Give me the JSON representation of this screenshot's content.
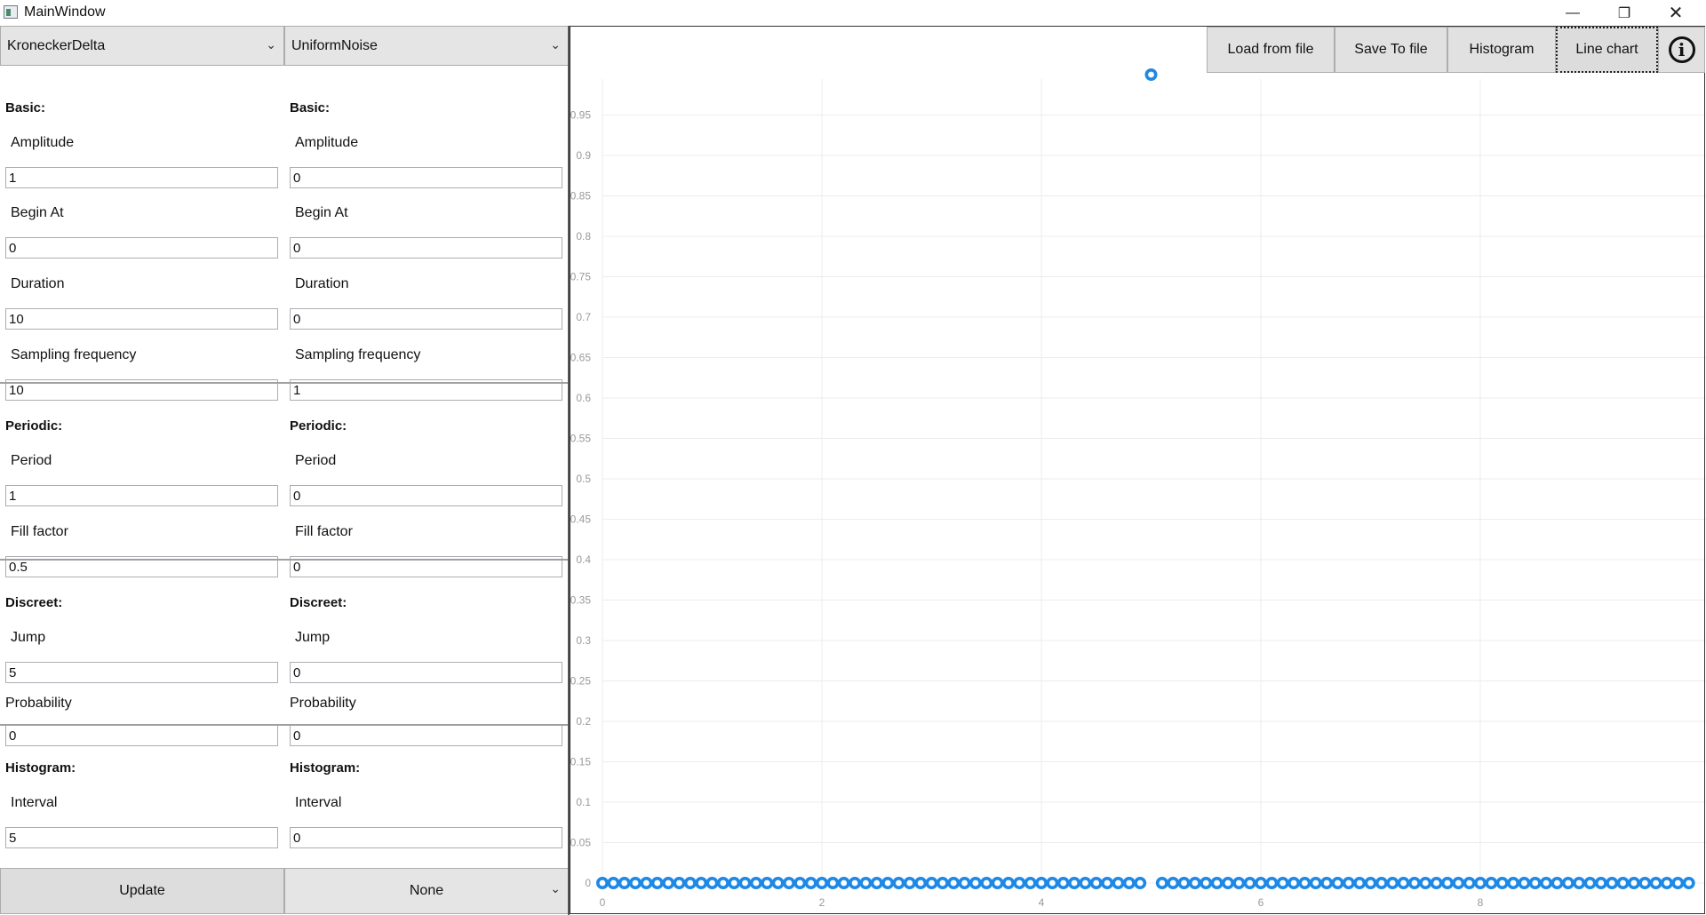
{
  "window": {
    "title": "MainWindow",
    "minimize_icon": "minimize-icon",
    "maximize_icon": "restore-icon",
    "close_icon": "close-icon"
  },
  "left": {
    "signal_select": "KroneckerDelta",
    "basic_title": "Basic:",
    "amplitude_label": "Amplitude",
    "amplitude": "1",
    "begin_label": "Begin At",
    "begin": "0",
    "duration_label": "Duration",
    "duration": "10",
    "sampling_label": "Sampling frequency",
    "sampling": "10",
    "periodic_title": "Periodic:",
    "period_label": "Period",
    "period": "1",
    "fill_label": "Fill factor",
    "fill": "0.5",
    "discreet_title": "Discreet:",
    "jump_label": "Jump",
    "jump": "5",
    "probability_label": "Probability",
    "probability": "0",
    "histogram_title": "Histogram:",
    "interval_label": "Interval",
    "interval": "5"
  },
  "right_form": {
    "signal_select": "UniformNoise",
    "basic_title": "Basic:",
    "amplitude_label": "Amplitude",
    "amplitude": "0",
    "begin_label": "Begin At",
    "begin": "0",
    "duration_label": "Duration",
    "duration": "0",
    "sampling_label": "Sampling frequency",
    "sampling": "1",
    "periodic_title": "Periodic:",
    "period_label": "Period",
    "period": "0",
    "fill_label": "Fill factor",
    "fill": "0",
    "discreet_title": "Discreet:",
    "jump_label": "Jump",
    "jump": "0",
    "probability_label": "Probability",
    "probability": "0",
    "histogram_title": "Histogram:",
    "interval_label": "Interval",
    "interval": "0"
  },
  "bottom": {
    "update_label": "Update",
    "operation_select": "None"
  },
  "toolbar": {
    "load_label": "Load from file",
    "save_label": "Save To file",
    "histogram_label": "Histogram",
    "linechart_label": "Line chart",
    "info_icon": "info-icon",
    "info_glyph": "i"
  },
  "chart_data": {
    "type": "scatter",
    "point_color": "#1e88e5",
    "grid": true,
    "xlim": [
      0,
      10
    ],
    "ylim": [
      0,
      1
    ],
    "xticks": [
      "0",
      "2",
      "4",
      "6",
      "8"
    ],
    "yticks": [
      "0",
      "0.05",
      "0.1",
      "0.15",
      "0.2",
      "0.25",
      "0.3",
      "0.35",
      "0.4",
      "0.45",
      "0.5",
      "0.55",
      "0.6",
      "0.65",
      "0.7",
      "0.75",
      "0.8",
      "0.85",
      "0.9",
      "0.95"
    ],
    "series": [
      {
        "x": [
          0,
          0.1,
          0.2,
          0.3,
          0.4,
          0.5,
          0.6,
          0.7,
          0.8,
          0.9,
          1,
          1.1,
          1.2,
          1.3,
          1.4,
          1.5,
          1.6,
          1.7,
          1.8,
          1.9,
          2,
          2.1,
          2.2,
          2.3,
          2.4,
          2.5,
          2.6,
          2.7,
          2.8,
          2.9,
          3,
          3.1,
          3.2,
          3.3,
          3.4,
          3.5,
          3.6,
          3.7,
          3.8,
          3.9,
          4,
          4.1,
          4.2,
          4.3,
          4.4,
          4.5,
          4.6,
          4.7,
          4.8,
          4.9,
          5,
          5.1,
          5.2,
          5.3,
          5.4,
          5.5,
          5.6,
          5.7,
          5.8,
          5.9,
          6,
          6.1,
          6.2,
          6.3,
          6.4,
          6.5,
          6.6,
          6.7,
          6.8,
          6.9,
          7,
          7.1,
          7.2,
          7.3,
          7.4,
          7.5,
          7.6,
          7.7,
          7.8,
          7.9,
          8,
          8.1,
          8.2,
          8.3,
          8.4,
          8.5,
          8.6,
          8.7,
          8.8,
          8.9,
          9,
          9.1,
          9.2,
          9.3,
          9.4,
          9.5,
          9.6,
          9.7,
          9.8,
          9.9
        ],
        "y": [
          0,
          0,
          0,
          0,
          0,
          0,
          0,
          0,
          0,
          0,
          0,
          0,
          0,
          0,
          0,
          0,
          0,
          0,
          0,
          0,
          0,
          0,
          0,
          0,
          0,
          0,
          0,
          0,
          0,
          0,
          0,
          0,
          0,
          0,
          0,
          0,
          0,
          0,
          0,
          0,
          0,
          0,
          0,
          0,
          0,
          0,
          0,
          0,
          0,
          0,
          1,
          0,
          0,
          0,
          0,
          0,
          0,
          0,
          0,
          0,
          0,
          0,
          0,
          0,
          0,
          0,
          0,
          0,
          0,
          0,
          0,
          0,
          0,
          0,
          0,
          0,
          0,
          0,
          0,
          0,
          0,
          0,
          0,
          0,
          0,
          0,
          0,
          0,
          0,
          0,
          0,
          0,
          0,
          0,
          0,
          0,
          0,
          0,
          0,
          0
        ]
      }
    ]
  }
}
